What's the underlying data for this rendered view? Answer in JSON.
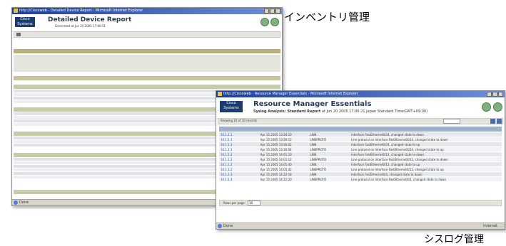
{
  "captions": {
    "inventory": "インベントリ管理",
    "syslog": "シスログ管理"
  },
  "window1": {
    "title": "http://Ciscoweb - Detailed Device Report - Microsoft Internet Explorer",
    "logo": "Cisco Systems",
    "heading": "Detailed Device Report",
    "subheading": "Generated at Jun 20 2005 17:06:51",
    "status": "Done"
  },
  "window2": {
    "title": "http://Ciscoweb - Resource Manager Essentials - Microsoft Internet Explorer",
    "logo": "Cisco Systems",
    "heading": "Resource Manager Essentials",
    "subheading": "Syslog Analysis: Standard Report",
    "subheading_detail": "at Jun 20 2005 17:06:21 Japan Standard Time(GMT+09:00)",
    "toolbar_label": "Showing 10 of 10 records",
    "rows_per_page_label": "Rows per page:",
    "rows_per_page_value": "10",
    "status": "Done",
    "zone": "Internet",
    "rows": [
      {
        "device": "10.1.1.1",
        "time": "Apr 15 2005 13:26:10",
        "type": "LINK",
        "text": "Interface FastEthernet0/24, changed state to down"
      },
      {
        "device": "10.1.1.1",
        "time": "Apr 15 2005 13:26:12",
        "type": "LINEPROTO",
        "text": "Line protocol on Interface FastEthernet0/24, changed state to down"
      },
      {
        "device": "10.1.1.1",
        "time": "Apr 15 2005 13:30:02",
        "type": "LINK",
        "text": "Interface FastEthernet0/24, changed state to up"
      },
      {
        "device": "10.1.1.1",
        "time": "Apr 15 2005 13:30:04",
        "type": "LINEPROTO",
        "text": "Line protocol on Interface FastEthernet0/24, changed state to up"
      },
      {
        "device": "10.1.1.2",
        "time": "Apr 15 2005 14:01:10",
        "type": "LINK",
        "text": "Interface FastEthernet0/12, changed state to down"
      },
      {
        "device": "10.1.1.2",
        "time": "Apr 15 2005 14:01:12",
        "type": "LINEPROTO",
        "text": "Line protocol on Interface FastEthernet0/12, changed state to down"
      },
      {
        "device": "10.1.1.2",
        "time": "Apr 15 2005 14:05:40",
        "type": "LINK",
        "text": "Interface FastEthernet0/12, changed state to up"
      },
      {
        "device": "10.1.1.2",
        "time": "Apr 15 2005 14:05:42",
        "type": "LINEPROTO",
        "text": "Line protocol on Interface FastEthernet0/12, changed state to up"
      },
      {
        "device": "10.1.1.3",
        "time": "Apr 15 2005 14:22:18",
        "type": "LINK",
        "text": "Interface FastEthernet0/3, changed state to down"
      },
      {
        "device": "10.1.1.3",
        "time": "Apr 15 2005 14:22:20",
        "type": "LINEPROTO",
        "text": "Line protocol on Interface FastEthernet0/3, changed state to down"
      }
    ]
  }
}
